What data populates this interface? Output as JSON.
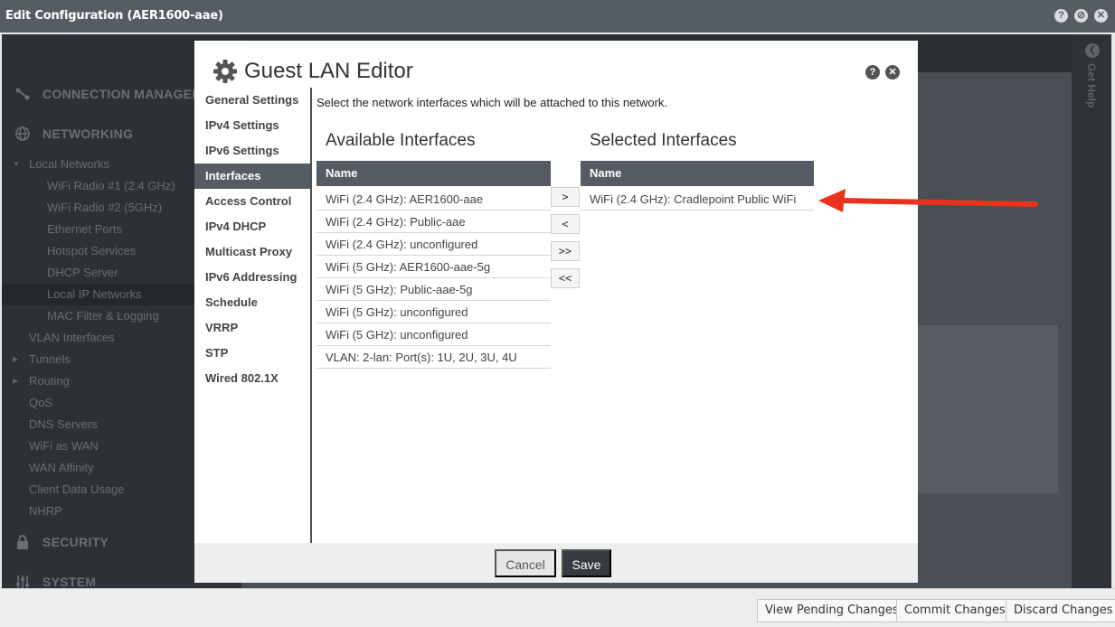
{
  "window": {
    "title": "Edit Configuration (AER1600-aae)",
    "controls": {
      "help": "?",
      "minimize": "⊘",
      "close": "✕"
    }
  },
  "background": {
    "sections": [
      {
        "label": "CONNECTION MANAGER",
        "icon": "connection-icon"
      },
      {
        "label": "NETWORKING",
        "icon": "globe-icon"
      },
      {
        "label": "SECURITY",
        "icon": "lock-icon"
      },
      {
        "label": "SYSTEM",
        "icon": "sliders-icon"
      }
    ],
    "networking_items": [
      {
        "label": "Local Networks",
        "level": 0,
        "expanded": true
      },
      {
        "label": "WiFi Radio #1 (2.4 GHz)",
        "level": 1
      },
      {
        "label": "WiFi Radio #2 (5GHz)",
        "level": 1
      },
      {
        "label": "Ethernet Ports",
        "level": 1
      },
      {
        "label": "Hotspot Services",
        "level": 1
      },
      {
        "label": "DHCP Server",
        "level": 1
      },
      {
        "label": "Local IP Networks",
        "level": 1,
        "selected": true
      },
      {
        "label": "MAC Filter & Logging",
        "level": 1
      },
      {
        "label": "VLAN Interfaces",
        "level": 0
      },
      {
        "label": "Tunnels",
        "level": 0,
        "collapsed": true
      },
      {
        "label": "Routing",
        "level": 0,
        "collapsed": true
      },
      {
        "label": "QoS",
        "level": 0
      },
      {
        "label": "DNS Servers",
        "level": 0
      },
      {
        "label": "WiFi as WAN",
        "level": 0
      },
      {
        "label": "WAN Affinity",
        "level": 0
      },
      {
        "label": "Client Data Usage",
        "level": 0
      },
      {
        "label": "NHRP",
        "level": 0
      }
    ],
    "help_panel": {
      "label": "Get Help"
    }
  },
  "modal": {
    "title": "Guest LAN Editor",
    "help_label": "?",
    "close_label": "✕",
    "nav": [
      {
        "label": "General Settings"
      },
      {
        "label": "IPv4 Settings"
      },
      {
        "label": "IPv6 Settings"
      },
      {
        "label": "Interfaces",
        "active": true
      },
      {
        "label": "Access Control"
      },
      {
        "label": "IPv4 DHCP"
      },
      {
        "label": "Multicast Proxy"
      },
      {
        "label": "IPv6 Addressing"
      },
      {
        "label": "Schedule"
      },
      {
        "label": "VRRP"
      },
      {
        "label": "STP"
      },
      {
        "label": "Wired 802.1X"
      }
    ],
    "description": "Select the network interfaces which will be attached to this network.",
    "available": {
      "title": "Available Interfaces",
      "column": "Name",
      "rows": [
        "WiFi (2.4 GHz): AER1600-aae",
        "WiFi (2.4 GHz): Public-aae",
        "WiFi (2.4 GHz): unconfigured",
        "WiFi (5 GHz): AER1600-aae-5g",
        "WiFi (5 GHz): Public-aae-5g",
        "WiFi (5 GHz): unconfigured",
        "WiFi (5 GHz): unconfigured",
        "VLAN: 2-lan: Port(s): 1U, 2U, 3U, 4U"
      ]
    },
    "selected": {
      "title": "Selected Interfaces",
      "column": "Name",
      "rows": [
        "WiFi (2.4 GHz): Cradlepoint Public WiFi"
      ]
    },
    "move_buttons": {
      "add": ">",
      "remove": "<",
      "add_all": ">>",
      "remove_all": "<<"
    },
    "footer": {
      "cancel_label": "Cancel",
      "save_label": "Save"
    }
  },
  "bottom_bar": {
    "view_pending_label": "View Pending Changes",
    "commit_label": "Commit Changes",
    "discard_label": "Discard Changes"
  },
  "annotation": {
    "arrow_color": "#e8321e"
  }
}
